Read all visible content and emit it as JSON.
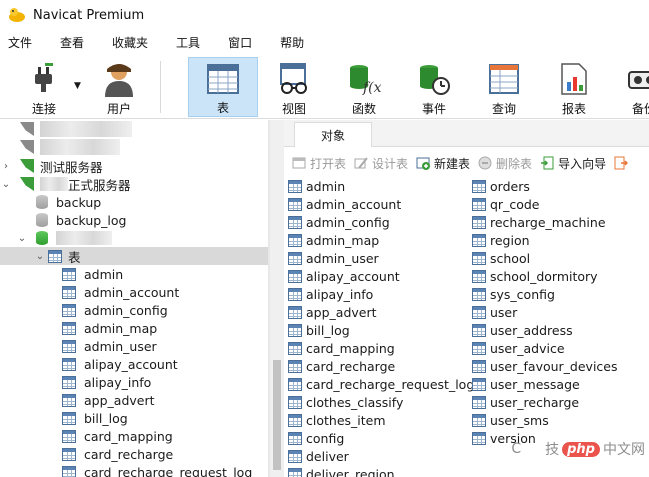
{
  "app": {
    "title": "Navicat Premium"
  },
  "menu": [
    "文件",
    "查看",
    "收藏夹",
    "工具",
    "窗口",
    "帮助"
  ],
  "toolbar": [
    {
      "label": "连接",
      "icon": "plug-icon"
    },
    {
      "label": "用户",
      "icon": "user-icon"
    },
    {
      "label": "表",
      "icon": "table-icon",
      "active": true
    },
    {
      "label": "视图",
      "icon": "view-glasses-icon"
    },
    {
      "label": "函数",
      "icon": "function-icon"
    },
    {
      "label": "事件",
      "icon": "event-clock-icon"
    },
    {
      "label": "查询",
      "icon": "query-icon"
    },
    {
      "label": "报表",
      "icon": "report-icon"
    },
    {
      "label": "备份",
      "icon": "backup-icon"
    }
  ],
  "tree": {
    "server_test": "测试服务器",
    "server_prod": "正式服务器",
    "db_backup": "backup",
    "db_backup_log": "backup_log",
    "tables_folder": "表",
    "tables": [
      "admin",
      "admin_account",
      "admin_config",
      "admin_map",
      "admin_user",
      "alipay_account",
      "alipay_info",
      "app_advert",
      "bill_log",
      "card_mapping",
      "card_recharge",
      "card_recharge_request_log"
    ]
  },
  "tabs": {
    "object": "对象"
  },
  "objtoolbar": {
    "open": "打开表",
    "design": "设计表",
    "new": "新建表",
    "delete": "删除表",
    "import": "导入向导"
  },
  "objects_col1": [
    "admin",
    "admin_account",
    "admin_config",
    "admin_map",
    "admin_user",
    "alipay_account",
    "alipay_info",
    "app_advert",
    "bill_log",
    "card_mapping",
    "card_recharge",
    "card_recharge_request_log",
    "clothes_classify",
    "clothes_item",
    "config",
    "deliver",
    "deliver_region"
  ],
  "objects_col2": [
    "orders",
    "qr_code",
    "recharge_machine",
    "region",
    "school",
    "school_dormitory",
    "sys_config",
    "user",
    "user_address",
    "user_advice",
    "user_favour_devices",
    "user_message",
    "user_recharge",
    "user_sms",
    "version"
  ],
  "watermark": {
    "pre": "C",
    "mid": "技",
    "brand": "php",
    "post": "中文网"
  },
  "colors": {
    "accent": "#cce4f7",
    "server_green": "#3a9d3a",
    "table_blue": "#4a6f98"
  }
}
